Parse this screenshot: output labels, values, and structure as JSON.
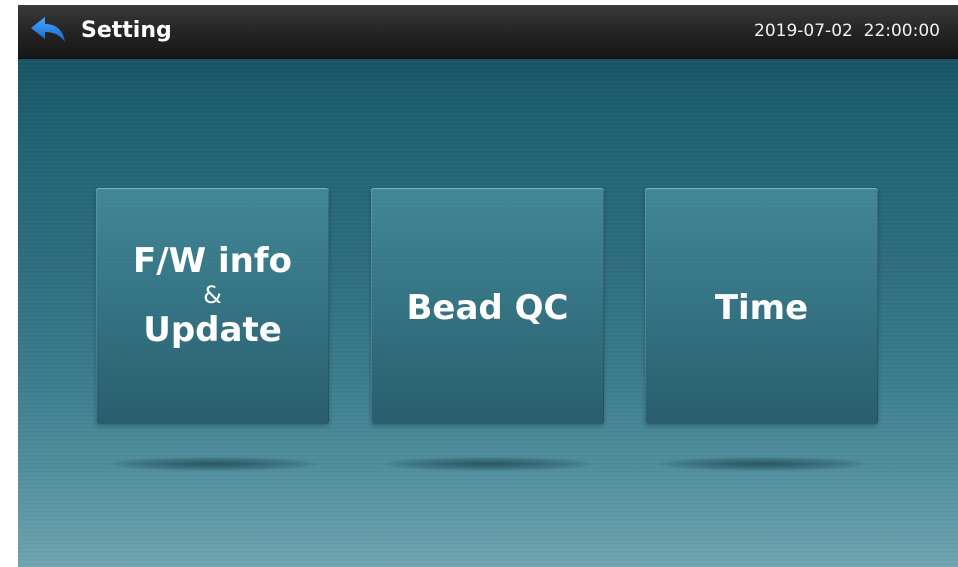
{
  "header": {
    "title": "Setting",
    "datetime": "2019-07-02  22:00:00",
    "back_icon": "back-arrow-icon"
  },
  "menu": {
    "tiles": [
      {
        "line1": "F/W info",
        "line2": "&",
        "line3": "Update"
      },
      {
        "label": "Bead QC"
      },
      {
        "label": "Time"
      }
    ]
  },
  "colors": {
    "topbar": "#232323",
    "background_top": "#134b5a",
    "background_bottom": "#6fa4b1",
    "back_arrow": "#1f7fe0",
    "text": "#ffffff"
  }
}
